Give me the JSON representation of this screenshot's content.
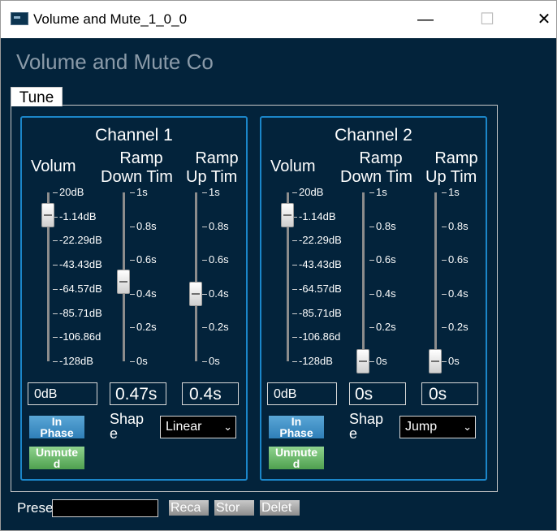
{
  "window": {
    "title": "Volume and Mute_1_0_0",
    "minimize_glyph": "—",
    "maximize_glyph": "☐",
    "close_glyph": "✕"
  },
  "app": {
    "heading": "Volume and Mute Co"
  },
  "tabs": [
    {
      "label": "Tune",
      "selected": true
    }
  ],
  "channels": [
    {
      "title": "Channel 1",
      "volume": {
        "label": "Volum",
        "ticks": [
          "20dB",
          "-1.14dB",
          "-22.29dB",
          "-43.43dB",
          "-64.57dB",
          "-85.71dB",
          "-106.86d",
          "-128dB"
        ],
        "value_text": "0dB",
        "level_fraction": 0.865
      },
      "ramp_down": {
        "label_line1": "Ramp",
        "label_line2": "Down Tim",
        "ticks": [
          "1s",
          "0.8s",
          "0.6s",
          "0.4s",
          "0.2s",
          "0s"
        ],
        "value_text": "0.47s",
        "level_fraction": 0.47
      },
      "ramp_up": {
        "label_line1": "Ramp",
        "label_line2": "Up Tim",
        "ticks": [
          "1s",
          "0.8s",
          "0.6s",
          "0.4s",
          "0.2s",
          "0s"
        ],
        "value_text": "0.4s",
        "level_fraction": 0.4
      },
      "phase_button": {
        "line1": "In",
        "line2": "Phase"
      },
      "mute_button": {
        "line1": "Unmute",
        "line2": "d"
      },
      "shape": {
        "label_line1": "Shap",
        "label_line2": "e",
        "selected": "Linear",
        "chevron": "⌄"
      }
    },
    {
      "title": "Channel 2",
      "volume": {
        "label": "Volum",
        "ticks": [
          "20dB",
          "-1.14dB",
          "-22.29dB",
          "-43.43dB",
          "-64.57dB",
          "-85.71dB",
          "-106.86d",
          "-128dB"
        ],
        "value_text": "0dB",
        "level_fraction": 0.865
      },
      "ramp_down": {
        "label_line1": "Ramp",
        "label_line2": "Down Tim",
        "ticks": [
          "1s",
          "0.8s",
          "0.6s",
          "0.4s",
          "0.2s",
          "0s"
        ],
        "value_text": "0s",
        "level_fraction": 0
      },
      "ramp_up": {
        "label_line1": "Ramp",
        "label_line2": "Up Tim",
        "ticks": [
          "1s",
          "0.8s",
          "0.6s",
          "0.4s",
          "0.2s",
          "0s"
        ],
        "value_text": "0s",
        "level_fraction": 0
      },
      "phase_button": {
        "line1": "In",
        "line2": "Phase"
      },
      "mute_button": {
        "line1": "Unmute",
        "line2": "d"
      },
      "shape": {
        "label_line1": "Shap",
        "label_line2": "e",
        "selected": "Jump",
        "chevron": "⌄"
      }
    }
  ],
  "presets": {
    "label": "Prese",
    "input_value": "",
    "recall_label": "Reca",
    "store_label": "Stor",
    "delete_label": "Delet"
  },
  "colors": {
    "background": "#03233b",
    "channel_border": "#1b86c9",
    "phase_button": "#2f7fb8",
    "mute_button": "#4fa04f"
  }
}
